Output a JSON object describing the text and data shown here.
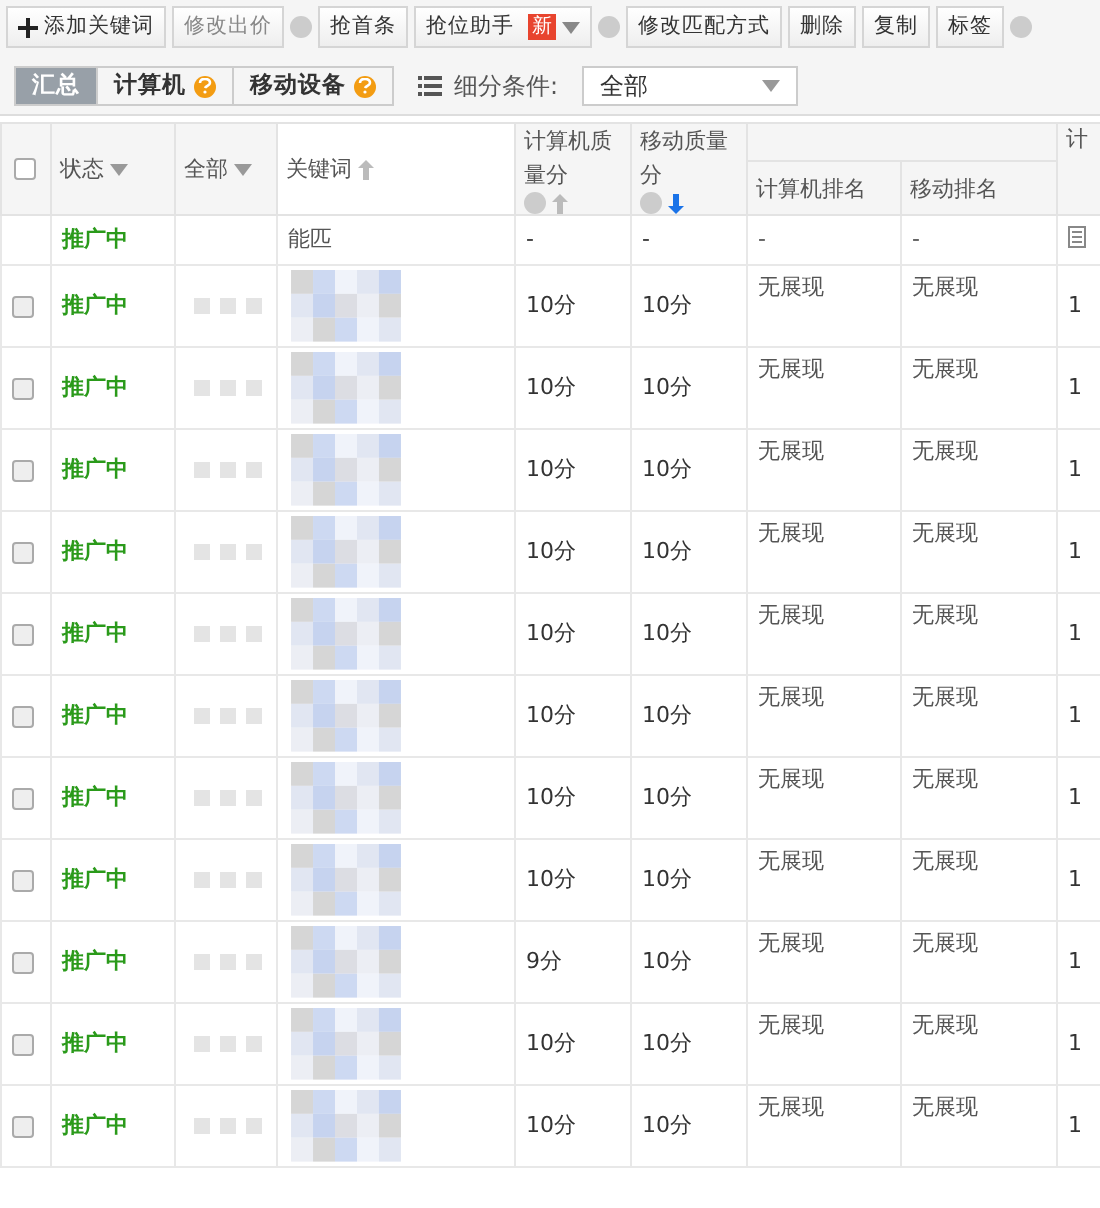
{
  "toolbar": [
    {
      "kind": "add",
      "label": "添加关键词",
      "disabled": false
    },
    {
      "kind": "button",
      "label": "修改出价",
      "disabled": true
    },
    {
      "kind": "help"
    },
    {
      "kind": "button",
      "label": "抢首条",
      "disabled": false
    },
    {
      "kind": "button",
      "label": "抢位助手",
      "badge": "新",
      "dropdown": true,
      "disabled": false
    },
    {
      "kind": "help"
    },
    {
      "kind": "button",
      "label": "修改匹配方式",
      "disabled": false
    },
    {
      "kind": "button",
      "label": "删除",
      "disabled": false
    },
    {
      "kind": "button",
      "label": "复制",
      "disabled": false
    },
    {
      "kind": "button",
      "label": "标签",
      "disabled": false
    },
    {
      "kind": "help"
    }
  ],
  "view_tabs": [
    {
      "label": "汇总",
      "selected": true,
      "help": false
    },
    {
      "label": "计算机",
      "selected": false,
      "help": true
    },
    {
      "label": "移动设备",
      "selected": false,
      "help": true
    }
  ],
  "filter": {
    "label": "细分条件:",
    "value": "全部"
  },
  "table": {
    "select_all_checked": false,
    "columns": [
      {
        "label": "状态",
        "dropdown": true
      },
      {
        "label": "全部",
        "dropdown": true
      },
      {
        "label": "关键词",
        "help": false,
        "sort_descending": false,
        "active": false
      },
      {
        "label": "计算机质量分",
        "help": true,
        "sort_descending": false,
        "active": false
      },
      {
        "label": "移动质量分",
        "help": true,
        "sort_descending": true,
        "active": true
      },
      {
        "label": "计算机排名"
      },
      {
        "label": "移动排名"
      },
      {
        "label": "计"
      }
    ],
    "rows": [
      {
        "kind": "summary",
        "status": "推广中",
        "keyword": "能匹",
        "pc_quality": "-",
        "mobile_quality": "-",
        "pc_rank": "-",
        "mobile_rank": "-"
      },
      {
        "kind": "keyword",
        "checked": false,
        "status": "推广中",
        "pc_quality": "10分",
        "mobile_quality": "10分",
        "pc_rank": "无展现",
        "mobile_rank": "无展现",
        "column_8": "1"
      },
      {
        "kind": "keyword",
        "checked": false,
        "status": "推广中",
        "pc_quality": "10分",
        "mobile_quality": "10分",
        "pc_rank": "无展现",
        "mobile_rank": "无展现",
        "column_8": "1"
      },
      {
        "kind": "keyword",
        "checked": false,
        "status": "推广中",
        "pc_quality": "10分",
        "mobile_quality": "10分",
        "pc_rank": "无展现",
        "mobile_rank": "无展现",
        "column_8": "1"
      },
      {
        "kind": "keyword",
        "checked": false,
        "status": "推广中",
        "pc_quality": "10分",
        "mobile_quality": "10分",
        "pc_rank": "无展现",
        "mobile_rank": "无展现",
        "column_8": "1"
      },
      {
        "kind": "keyword",
        "checked": false,
        "status": "推广中",
        "pc_quality": "10分",
        "mobile_quality": "10分",
        "pc_rank": "无展现",
        "mobile_rank": "无展现",
        "column_8": "1"
      },
      {
        "kind": "keyword",
        "checked": false,
        "status": "推广中",
        "pc_quality": "10分",
        "mobile_quality": "10分",
        "pc_rank": "无展现",
        "mobile_rank": "无展现",
        "column_8": "1"
      },
      {
        "kind": "keyword",
        "checked": false,
        "status": "推广中",
        "pc_quality": "10分",
        "mobile_quality": "10分",
        "pc_rank": "无展现",
        "mobile_rank": "无展现",
        "column_8": "1"
      },
      {
        "kind": "keyword",
        "checked": false,
        "status": "推广中",
        "pc_quality": "10分",
        "mobile_quality": "10分",
        "pc_rank": "无展现",
        "mobile_rank": "无展现",
        "column_8": "1"
      },
      {
        "kind": "keyword",
        "checked": false,
        "status": "推广中",
        "pc_quality": "9分",
        "mobile_quality": "10分",
        "pc_rank": "无展现",
        "mobile_rank": "无展现",
        "column_8": "1"
      },
      {
        "kind": "keyword",
        "checked": false,
        "status": "推广中",
        "pc_quality": "10分",
        "mobile_quality": "10分",
        "pc_rank": "无展现",
        "mobile_rank": "无展现",
        "column_8": "1"
      },
      {
        "kind": "keyword",
        "checked": false,
        "status": "推广中",
        "pc_quality": "10分",
        "mobile_quality": "10分",
        "pc_rank": "无展现",
        "mobile_rank": "无展现",
        "column_8": "1"
      }
    ]
  }
}
